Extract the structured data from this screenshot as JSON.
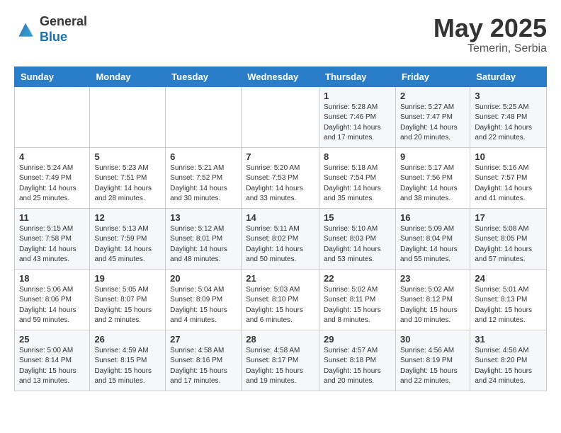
{
  "header": {
    "logo_general": "General",
    "logo_blue": "Blue",
    "month_year": "May 2025",
    "location": "Temerin, Serbia"
  },
  "days_of_week": [
    "Sunday",
    "Monday",
    "Tuesday",
    "Wednesday",
    "Thursday",
    "Friday",
    "Saturday"
  ],
  "weeks": [
    [
      {
        "num": "",
        "info": ""
      },
      {
        "num": "",
        "info": ""
      },
      {
        "num": "",
        "info": ""
      },
      {
        "num": "",
        "info": ""
      },
      {
        "num": "1",
        "info": "Sunrise: 5:28 AM\nSunset: 7:46 PM\nDaylight: 14 hours\nand 17 minutes."
      },
      {
        "num": "2",
        "info": "Sunrise: 5:27 AM\nSunset: 7:47 PM\nDaylight: 14 hours\nand 20 minutes."
      },
      {
        "num": "3",
        "info": "Sunrise: 5:25 AM\nSunset: 7:48 PM\nDaylight: 14 hours\nand 22 minutes."
      }
    ],
    [
      {
        "num": "4",
        "info": "Sunrise: 5:24 AM\nSunset: 7:49 PM\nDaylight: 14 hours\nand 25 minutes."
      },
      {
        "num": "5",
        "info": "Sunrise: 5:23 AM\nSunset: 7:51 PM\nDaylight: 14 hours\nand 28 minutes."
      },
      {
        "num": "6",
        "info": "Sunrise: 5:21 AM\nSunset: 7:52 PM\nDaylight: 14 hours\nand 30 minutes."
      },
      {
        "num": "7",
        "info": "Sunrise: 5:20 AM\nSunset: 7:53 PM\nDaylight: 14 hours\nand 33 minutes."
      },
      {
        "num": "8",
        "info": "Sunrise: 5:18 AM\nSunset: 7:54 PM\nDaylight: 14 hours\nand 35 minutes."
      },
      {
        "num": "9",
        "info": "Sunrise: 5:17 AM\nSunset: 7:56 PM\nDaylight: 14 hours\nand 38 minutes."
      },
      {
        "num": "10",
        "info": "Sunrise: 5:16 AM\nSunset: 7:57 PM\nDaylight: 14 hours\nand 41 minutes."
      }
    ],
    [
      {
        "num": "11",
        "info": "Sunrise: 5:15 AM\nSunset: 7:58 PM\nDaylight: 14 hours\nand 43 minutes."
      },
      {
        "num": "12",
        "info": "Sunrise: 5:13 AM\nSunset: 7:59 PM\nDaylight: 14 hours\nand 45 minutes."
      },
      {
        "num": "13",
        "info": "Sunrise: 5:12 AM\nSunset: 8:01 PM\nDaylight: 14 hours\nand 48 minutes."
      },
      {
        "num": "14",
        "info": "Sunrise: 5:11 AM\nSunset: 8:02 PM\nDaylight: 14 hours\nand 50 minutes."
      },
      {
        "num": "15",
        "info": "Sunrise: 5:10 AM\nSunset: 8:03 PM\nDaylight: 14 hours\nand 53 minutes."
      },
      {
        "num": "16",
        "info": "Sunrise: 5:09 AM\nSunset: 8:04 PM\nDaylight: 14 hours\nand 55 minutes."
      },
      {
        "num": "17",
        "info": "Sunrise: 5:08 AM\nSunset: 8:05 PM\nDaylight: 14 hours\nand 57 minutes."
      }
    ],
    [
      {
        "num": "18",
        "info": "Sunrise: 5:06 AM\nSunset: 8:06 PM\nDaylight: 14 hours\nand 59 minutes."
      },
      {
        "num": "19",
        "info": "Sunrise: 5:05 AM\nSunset: 8:07 PM\nDaylight: 15 hours\nand 2 minutes."
      },
      {
        "num": "20",
        "info": "Sunrise: 5:04 AM\nSunset: 8:09 PM\nDaylight: 15 hours\nand 4 minutes."
      },
      {
        "num": "21",
        "info": "Sunrise: 5:03 AM\nSunset: 8:10 PM\nDaylight: 15 hours\nand 6 minutes."
      },
      {
        "num": "22",
        "info": "Sunrise: 5:02 AM\nSunset: 8:11 PM\nDaylight: 15 hours\nand 8 minutes."
      },
      {
        "num": "23",
        "info": "Sunrise: 5:02 AM\nSunset: 8:12 PM\nDaylight: 15 hours\nand 10 minutes."
      },
      {
        "num": "24",
        "info": "Sunrise: 5:01 AM\nSunset: 8:13 PM\nDaylight: 15 hours\nand 12 minutes."
      }
    ],
    [
      {
        "num": "25",
        "info": "Sunrise: 5:00 AM\nSunset: 8:14 PM\nDaylight: 15 hours\nand 13 minutes."
      },
      {
        "num": "26",
        "info": "Sunrise: 4:59 AM\nSunset: 8:15 PM\nDaylight: 15 hours\nand 15 minutes."
      },
      {
        "num": "27",
        "info": "Sunrise: 4:58 AM\nSunset: 8:16 PM\nDaylight: 15 hours\nand 17 minutes."
      },
      {
        "num": "28",
        "info": "Sunrise: 4:58 AM\nSunset: 8:17 PM\nDaylight: 15 hours\nand 19 minutes."
      },
      {
        "num": "29",
        "info": "Sunrise: 4:57 AM\nSunset: 8:18 PM\nDaylight: 15 hours\nand 20 minutes."
      },
      {
        "num": "30",
        "info": "Sunrise: 4:56 AM\nSunset: 8:19 PM\nDaylight: 15 hours\nand 22 minutes."
      },
      {
        "num": "31",
        "info": "Sunrise: 4:56 AM\nSunset: 8:20 PM\nDaylight: 15 hours\nand 24 minutes."
      }
    ]
  ]
}
